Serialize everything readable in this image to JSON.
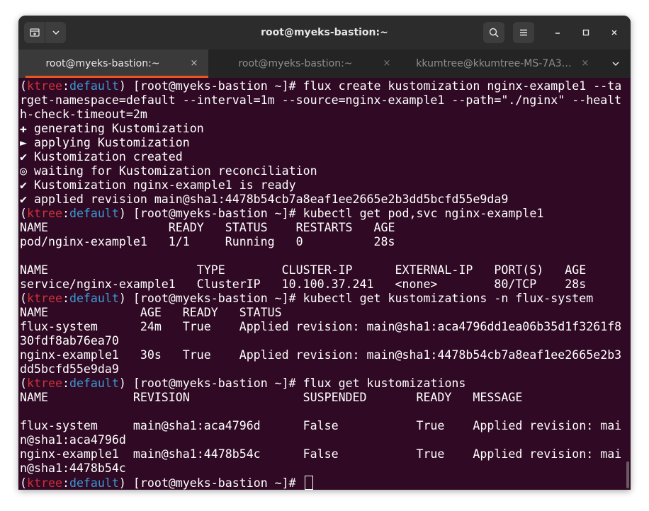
{
  "window": {
    "title": "root@myeks-bastion:~"
  },
  "tabs": [
    {
      "label": "root@myeks-bastion:~",
      "close": "×",
      "active": true
    },
    {
      "label": "root@myeks-bastion:~",
      "close": "×",
      "active": false
    },
    {
      "label": "kkumtree@kkumtree-MS-7A3…",
      "close": "×",
      "active": false
    }
  ],
  "icons": {
    "new_tab": "new-tab-icon",
    "dropdown": "chevron-down-icon",
    "search": "search-icon",
    "menu": "hamburger-menu-icon",
    "minimize": "minimize-icon",
    "maximize": "maximize-icon",
    "close": "close-icon",
    "tab_list": "chevron-down-icon"
  },
  "colors": {
    "terminal_bg": "#300a24",
    "accent": "#e95420",
    "prompt_user": "#cd3239",
    "prompt_namespace": "#3a9ad4"
  },
  "prompt": {
    "open_paren": "(",
    "user": "ktree",
    "colon": ":",
    "namespace": "default",
    "rest": ") [root@myeks-bastion ~]# "
  },
  "terminal_lines": [
    {
      "prompt": true,
      "text": "flux create kustomization nginx-example1 --ta"
    },
    {
      "prompt": false,
      "text": "rget-namespace=default --interval=1m --source=nginx-example1 --path=\"./nginx\" --healt"
    },
    {
      "prompt": false,
      "text": "h-check-timeout=2m"
    },
    {
      "prompt": false,
      "text": "✚ generating Kustomization"
    },
    {
      "prompt": false,
      "text": "► applying Kustomization"
    },
    {
      "prompt": false,
      "text": "✔ Kustomization created"
    },
    {
      "prompt": false,
      "text": "◎ waiting for Kustomization reconciliation"
    },
    {
      "prompt": false,
      "text": "✔ Kustomization nginx-example1 is ready"
    },
    {
      "prompt": false,
      "text": "✔ applied revision main@sha1:4478b54cb7a8eaf1ee2665e2b3dd5bcfd55e9da9"
    },
    {
      "prompt": true,
      "text": "kubectl get pod,svc nginx-example1"
    },
    {
      "prompt": false,
      "text": "NAME                 READY   STATUS    RESTARTS   AGE"
    },
    {
      "prompt": false,
      "text": "pod/nginx-example1   1/1     Running   0          28s"
    },
    {
      "prompt": false,
      "text": ""
    },
    {
      "prompt": false,
      "text": "NAME                     TYPE        CLUSTER-IP      EXTERNAL-IP   PORT(S)   AGE"
    },
    {
      "prompt": false,
      "text": "service/nginx-example1   ClusterIP   10.100.37.241   <none>        80/TCP    28s"
    },
    {
      "prompt": true,
      "text": "kubectl get kustomizations -n flux-system"
    },
    {
      "prompt": false,
      "text": "NAME             AGE   READY   STATUS"
    },
    {
      "prompt": false,
      "text": "flux-system      24m   True    Applied revision: main@sha1:aca4796dd1ea06b35d1f3261f8"
    },
    {
      "prompt": false,
      "text": "30fdf8ab76ea70"
    },
    {
      "prompt": false,
      "text": "nginx-example1   30s   True    Applied revision: main@sha1:4478b54cb7a8eaf1ee2665e2b3"
    },
    {
      "prompt": false,
      "text": "dd5bcfd55e9da9"
    },
    {
      "prompt": true,
      "text": "flux get kustomizations"
    },
    {
      "prompt": false,
      "text": "NAME            REVISION                SUSPENDED       READY   MESSAGE"
    },
    {
      "prompt": false,
      "text": ""
    },
    {
      "prompt": false,
      "text": "flux-system     main@sha1:aca4796d      False           True    Applied revision: mai"
    },
    {
      "prompt": false,
      "text": "n@sha1:aca4796d"
    },
    {
      "prompt": false,
      "text": "nginx-example1  main@sha1:4478b54c      False           True    Applied revision: mai"
    },
    {
      "prompt": false,
      "text": "n@sha1:4478b54c"
    },
    {
      "prompt": true,
      "text": "",
      "cursor": true
    }
  ]
}
